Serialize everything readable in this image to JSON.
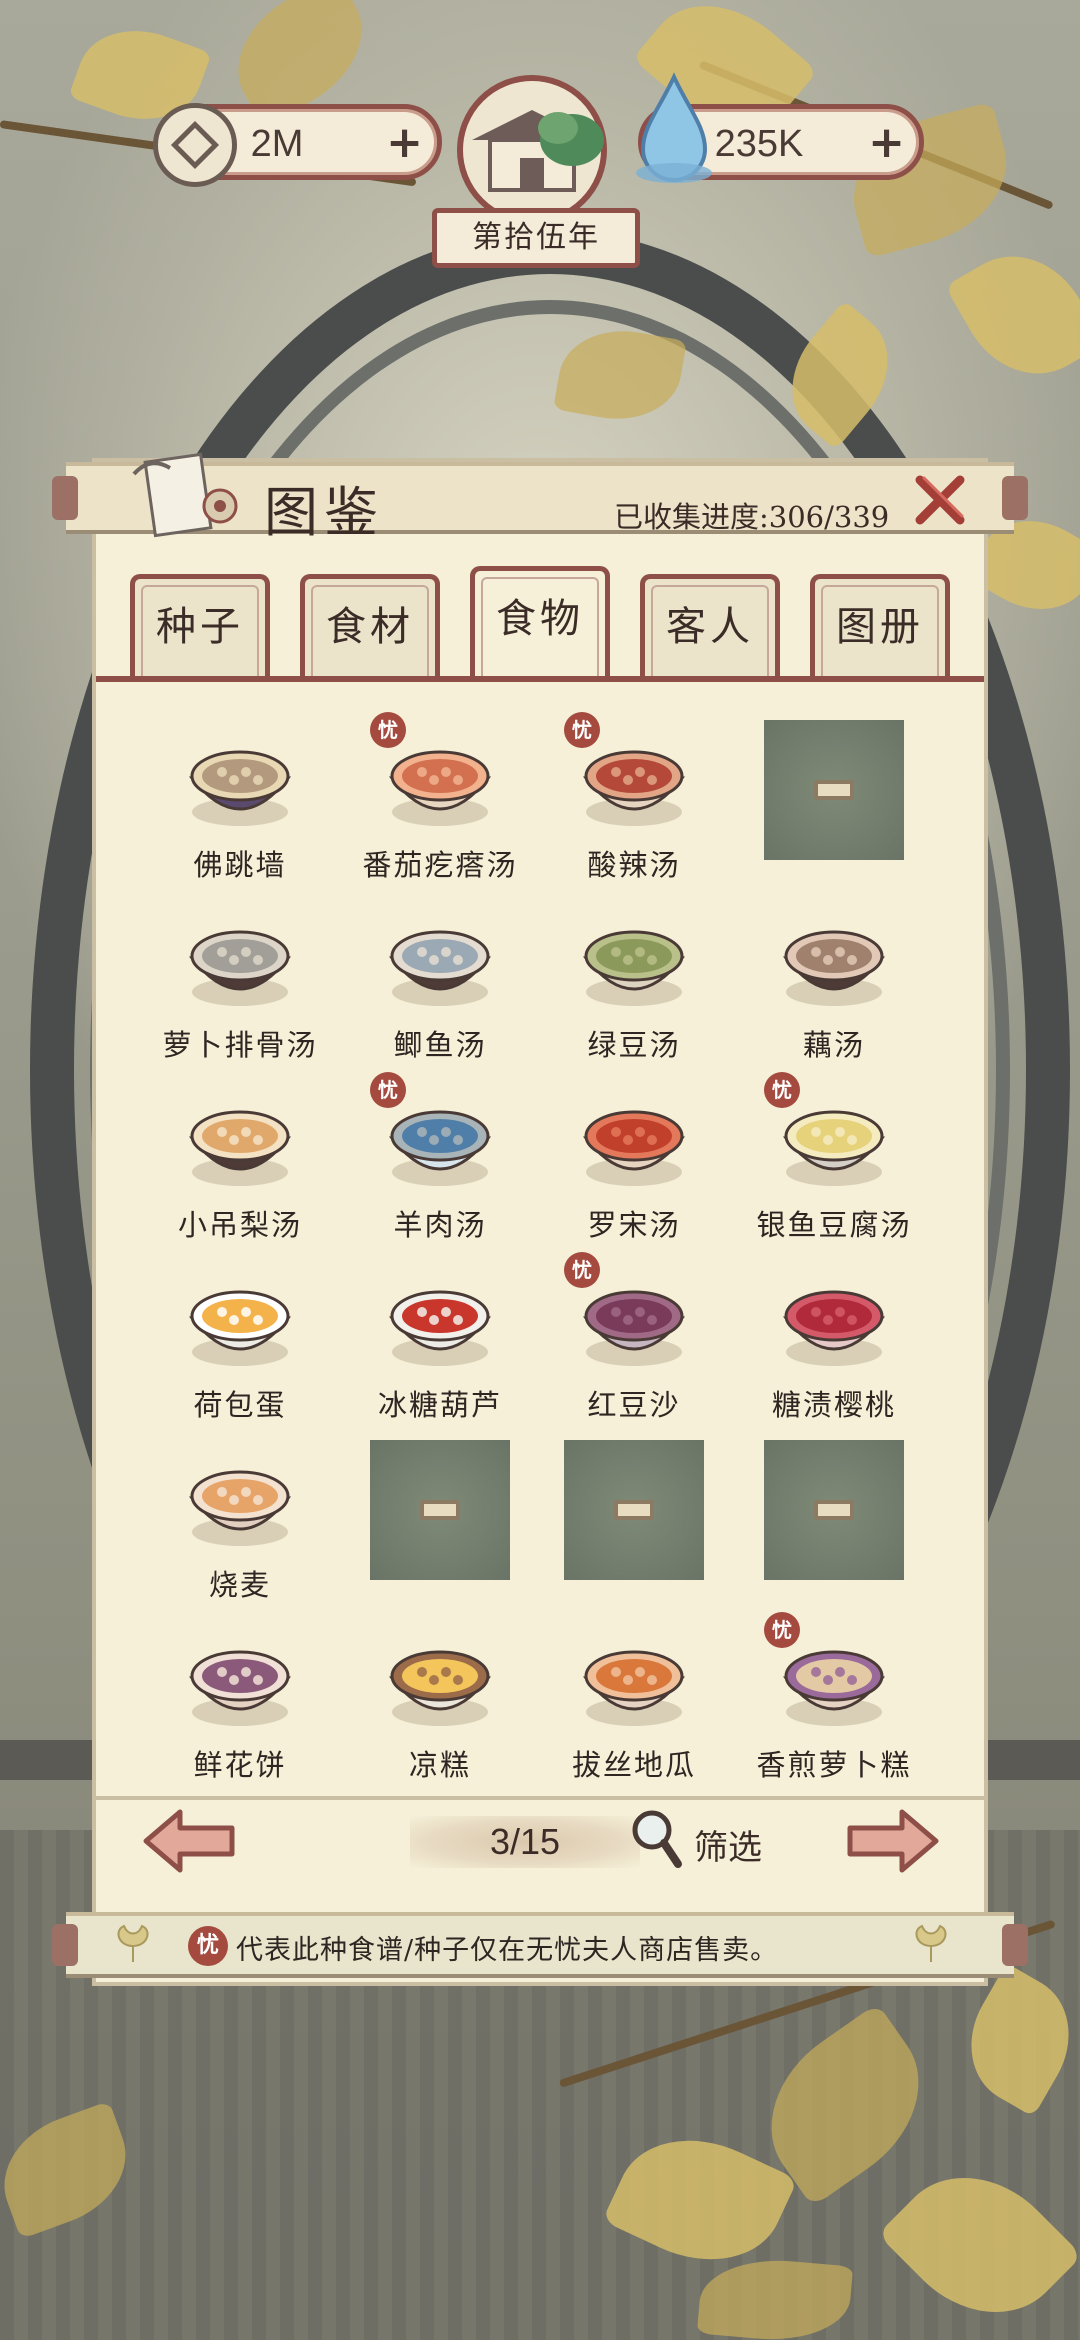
{
  "hud": {
    "coins": "2M",
    "water": "235K",
    "plus": "+",
    "year": "第拾伍年"
  },
  "panel": {
    "title": "图鉴",
    "progress": "已收集进度:306/339"
  },
  "tabs": [
    {
      "label": "种子"
    },
    {
      "label": "食材"
    },
    {
      "label": "食物",
      "active": true
    },
    {
      "label": "客人"
    },
    {
      "label": "图册"
    }
  ],
  "exclusive_badge": "忧",
  "items": [
    {
      "name": "佛跳墙",
      "icon": "buddha-jumps-wall-icon",
      "exclusive": false
    },
    {
      "name": "番茄疙瘩汤",
      "icon": "tomato-dumpling-soup-icon",
      "exclusive": true
    },
    {
      "name": "酸辣汤",
      "icon": "hot-sour-soup-icon",
      "exclusive": true
    },
    {
      "name": "",
      "locked": true
    },
    {
      "name": "萝卜排骨汤",
      "icon": "radish-rib-soup-icon",
      "exclusive": false
    },
    {
      "name": "鲫鱼汤",
      "icon": "crucian-fish-soup-icon",
      "exclusive": false
    },
    {
      "name": "绿豆汤",
      "icon": "mung-bean-soup-icon",
      "exclusive": false
    },
    {
      "name": "藕汤",
      "icon": "lotus-root-soup-icon",
      "exclusive": false
    },
    {
      "name": "小吊梨汤",
      "icon": "pear-soup-icon",
      "exclusive": false
    },
    {
      "name": "羊肉汤",
      "icon": "mutton-soup-icon",
      "exclusive": true
    },
    {
      "name": "罗宋汤",
      "icon": "borscht-icon",
      "exclusive": false
    },
    {
      "name": "银鱼豆腐汤",
      "icon": "whitebait-tofu-soup-icon",
      "exclusive": true
    },
    {
      "name": "荷包蛋",
      "icon": "fried-egg-icon",
      "exclusive": false
    },
    {
      "name": "冰糖葫芦",
      "icon": "candied-haws-icon",
      "exclusive": false
    },
    {
      "name": "红豆沙",
      "icon": "red-bean-paste-icon",
      "exclusive": true
    },
    {
      "name": "糖渍樱桃",
      "icon": "candied-cherry-icon",
      "exclusive": false
    },
    {
      "name": "烧麦",
      "icon": "shaomai-icon",
      "exclusive": false
    },
    {
      "name": "",
      "locked": true
    },
    {
      "name": "",
      "locked": true
    },
    {
      "name": "",
      "locked": true
    },
    {
      "name": "鲜花饼",
      "icon": "flower-cake-icon",
      "exclusive": false
    },
    {
      "name": "凉糕",
      "icon": "cold-cake-icon",
      "exclusive": false
    },
    {
      "name": "拔丝地瓜",
      "icon": "candied-sweet-potato-icon",
      "exclusive": false
    },
    {
      "name": "香煎萝卜糕",
      "icon": "radish-cake-icon",
      "exclusive": true
    }
  ],
  "pager": {
    "page": "3/15",
    "filter_label": "筛选"
  },
  "footer": {
    "note": "代表此种食谱/种子仅在无忧夫人商店售卖。"
  },
  "colors": {
    "frame": "#8d4f47",
    "paper": "#f6f0d8",
    "badge": "#a44a3f",
    "locked": "#737d6d"
  }
}
